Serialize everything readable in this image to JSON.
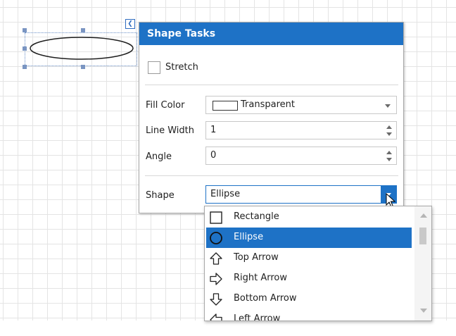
{
  "canvas": {
    "shape_kind": "ellipse"
  },
  "panel": {
    "title": "Shape Tasks",
    "stretch": {
      "label": "Stretch",
      "checked": false
    },
    "fill_color": {
      "label": "Fill Color",
      "value": "Transparent"
    },
    "line_width": {
      "label": "Line Width",
      "value": "1"
    },
    "angle": {
      "label": "Angle",
      "value": "0"
    },
    "shape": {
      "label": "Shape",
      "value": "Ellipse"
    }
  },
  "dropdown": {
    "options": [
      {
        "label": "Rectangle",
        "icon": "rectangle-icon"
      },
      {
        "label": "Ellipse",
        "icon": "ellipse-icon",
        "selected": true
      },
      {
        "label": "Top Arrow",
        "icon": "arrow-up-icon"
      },
      {
        "label": "Right Arrow",
        "icon": "arrow-right-icon"
      },
      {
        "label": "Bottom Arrow",
        "icon": "arrow-down-icon"
      },
      {
        "label": "Left Arrow",
        "icon": "arrow-left-icon"
      }
    ]
  },
  "colors": {
    "accent": "#1e72c6",
    "grid": "#e4e4e4"
  }
}
